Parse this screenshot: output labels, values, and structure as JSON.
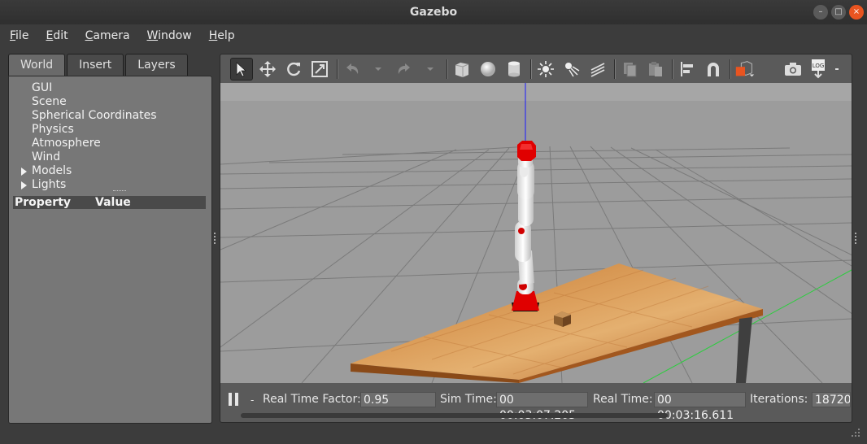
{
  "window": {
    "title": "Gazebo",
    "controls": [
      "–",
      "□",
      "×"
    ]
  },
  "menu": [
    "File",
    "Edit",
    "Camera",
    "Window",
    "Help"
  ],
  "tabs": [
    "World",
    "Insert",
    "Layers"
  ],
  "tree": [
    {
      "label": "GUI",
      "expandable": false
    },
    {
      "label": "Scene",
      "expandable": false
    },
    {
      "label": "Spherical Coordinates",
      "expandable": false
    },
    {
      "label": "Physics",
      "expandable": false
    },
    {
      "label": "Atmosphere",
      "expandable": false
    },
    {
      "label": "Wind",
      "expandable": false
    },
    {
      "label": "Models",
      "expandable": true
    },
    {
      "label": "Lights",
      "expandable": true
    }
  ],
  "properties": {
    "col1": "Property",
    "col2": "Value"
  },
  "toolbar": {
    "tools": [
      "select-arrow-icon",
      "translate-icon",
      "rotate-icon",
      "scale-icon",
      "undo-icon",
      "undo-dropdown-icon",
      "redo-icon",
      "redo-dropdown-icon",
      "box-shape-icon",
      "sphere-shape-icon",
      "cylinder-shape-icon",
      "point-light-icon",
      "spot-light-icon",
      "directional-light-icon",
      "copy-icon",
      "paste-icon",
      "align-icon",
      "snap-icon",
      "view-angle-icon",
      "screenshot-icon",
      "log-icon"
    ],
    "log_label": "LOG"
  },
  "status": {
    "real_time_factor_label": "Real Time Factor:",
    "real_time_factor": "0.95",
    "sim_time_label": "Sim Time:",
    "sim_time": "00 00:03:07.205",
    "real_time_label": "Real Time:",
    "real_time": "00 00:03:16.611",
    "iterations_label": "Iterations:",
    "iterations": "18720",
    "step_label": "-"
  },
  "colors": {
    "accent": "#e95420",
    "panel": "#777777",
    "robot_red": "#e00000"
  }
}
